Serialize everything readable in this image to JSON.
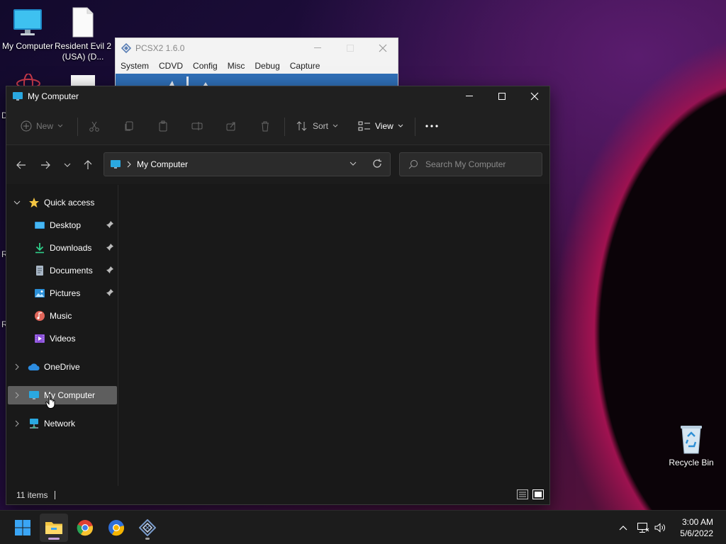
{
  "desktop": {
    "icons": [
      {
        "label": "My Computer"
      },
      {
        "label": "Resident Evil 2 (USA) (D..."
      },
      {
        "label": "Recycle Bin"
      }
    ],
    "edge_letters": [
      "D",
      "R",
      "R"
    ]
  },
  "pcsx2": {
    "title": "PCSX2  1.6.0",
    "menu": [
      "System",
      "CDVD",
      "Config",
      "Misc",
      "Debug",
      "Capture"
    ]
  },
  "explorer": {
    "title": "My Computer",
    "toolbar": {
      "new_label": "New",
      "sort_label": "Sort",
      "view_label": "View"
    },
    "address": {
      "crumb": "My Computer"
    },
    "search": {
      "placeholder": "Search My Computer"
    },
    "sidebar": {
      "quick_access": "Quick access",
      "items": [
        {
          "label": "Desktop",
          "pinned": true
        },
        {
          "label": "Downloads",
          "pinned": true
        },
        {
          "label": "Documents",
          "pinned": true
        },
        {
          "label": "Pictures",
          "pinned": true
        },
        {
          "label": "Music",
          "pinned": false
        },
        {
          "label": "Videos",
          "pinned": false
        }
      ],
      "onedrive": "OneDrive",
      "my_computer": "My Computer",
      "network": "Network"
    },
    "status": {
      "item_count": "11 items"
    }
  },
  "taskbar": {
    "clock_time": "3:00 AM",
    "clock_date": "5/6/2022"
  },
  "colors": {
    "accent": "#4cc2ff",
    "folder_yellow": "#f4c542",
    "selection_bg": "#5e5e5e"
  }
}
